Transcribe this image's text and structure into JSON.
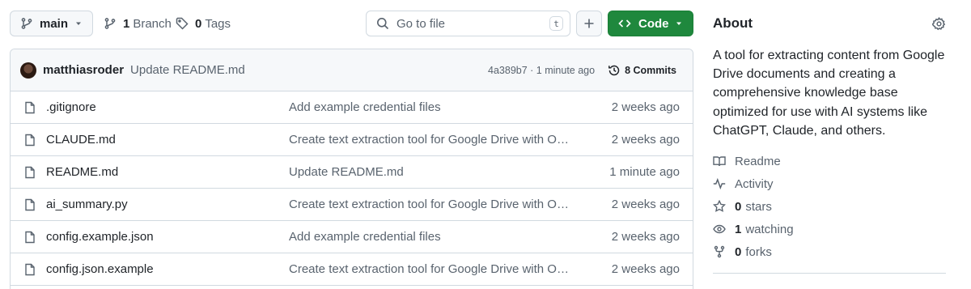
{
  "toolbar": {
    "branch": "main",
    "branches_count": "1",
    "branches_label": "Branch",
    "tags_count": "0",
    "tags_label": "Tags",
    "goto_placeholder": "Go to file",
    "goto_shortcut": "t",
    "code_label": "Code"
  },
  "latest_commit": {
    "author": "matthiasroder",
    "message": "Update README.md",
    "hash_time": "4a389b7 · 1 minute ago",
    "commits_count": "8",
    "commits_label": "Commits"
  },
  "files": [
    {
      "name": ".gitignore",
      "message": "Add example credential files",
      "date": "2 weeks ago"
    },
    {
      "name": "CLAUDE.md",
      "message": "Create text extraction tool for Google Drive with OpenAI integration",
      "date": "2 weeks ago"
    },
    {
      "name": "README.md",
      "message": "Update README.md",
      "date": "1 minute ago"
    },
    {
      "name": "ai_summary.py",
      "message": "Create text extraction tool for Google Drive with OpenAI integration",
      "date": "2 weeks ago"
    },
    {
      "name": "config.example.json",
      "message": "Add example credential files",
      "date": "2 weeks ago"
    },
    {
      "name": "config.json.example",
      "message": "Create text extraction tool for Google Drive with OpenAI integration",
      "date": "2 weeks ago"
    }
  ],
  "about": {
    "title": "About",
    "description": "A tool for extracting content from Google Drive documents and creating a comprehensive knowledge base optimized for use with AI systems like ChatGPT, Claude, and others.",
    "readme": "Readme",
    "activity": "Activity",
    "stars_count": "0",
    "stars_label": "stars",
    "watching_count": "1",
    "watching_label": "watching",
    "forks_count": "0",
    "forks_label": "forks"
  },
  "colors": {
    "accent_green": "#1f883d",
    "border": "#d1d9e0",
    "muted_text": "#59636e"
  }
}
